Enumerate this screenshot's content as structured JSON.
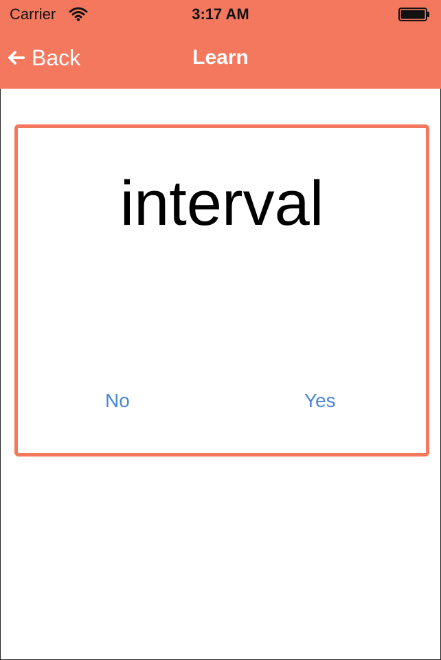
{
  "colors": {
    "accent": "#F4785E",
    "button_text": "#4A86D9"
  },
  "status_bar": {
    "carrier": "Carrier",
    "time": "3:17 AM",
    "wifi_icon": "wifi-icon",
    "battery_icon": "battery-icon"
  },
  "nav": {
    "back_label": "Back",
    "back_icon": "arrow-left-icon",
    "title": "Learn"
  },
  "card": {
    "word": "interval",
    "no_label": "No",
    "yes_label": "Yes"
  }
}
